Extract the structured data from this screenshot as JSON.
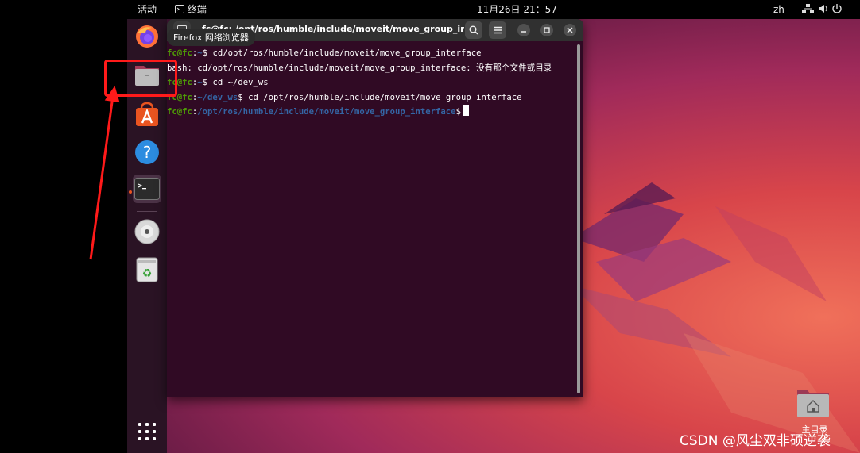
{
  "topbar": {
    "activities": "活动",
    "app_name": "终端",
    "clock": "11月26日  21：57",
    "lang": "zh"
  },
  "dock": {
    "items": [
      {
        "name": "firefox-icon"
      },
      {
        "name": "files-icon"
      },
      {
        "name": "app-store-icon"
      },
      {
        "name": "help-icon"
      },
      {
        "name": "terminal-icon",
        "active": true
      },
      {
        "name": "dvd-icon"
      },
      {
        "name": "trash-icon"
      }
    ],
    "tooltip": "Firefox 网络浏览器"
  },
  "terminal": {
    "title": "fc@fc: /opt/ros/humble/include/moveit/move_group_interf...",
    "lines": [
      {
        "user": "fc@fc",
        "path": "~",
        "cmd": " cd/opt/ros/humble/include/moveit/move_group_interface"
      },
      {
        "text": "bash: cd/opt/ros/humble/include/moveit/move_group_interface: 没有那个文件或目录"
      },
      {
        "user": "fc@fc",
        "path": "~",
        "cmd": " cd ~/dev_ws"
      },
      {
        "user": "fc@fc",
        "path": "~/dev_ws",
        "cmd": " cd /opt/ros/humble/include/moveit/move_group_interface"
      },
      {
        "user": "fc@fc",
        "path": "/opt/ros/humble/include/moveit/move_group_interface",
        "cmd": ""
      }
    ]
  },
  "desktop": {
    "home_label": "主目录"
  },
  "watermark": "CSDN @风尘双非硕逆袭",
  "colors": {
    "accent": "#e95420",
    "terminal_bg": "#300a24",
    "prompt_user": "#4e9a06",
    "prompt_path": "#3465a4",
    "annotation_red": "#ff1a1a"
  }
}
